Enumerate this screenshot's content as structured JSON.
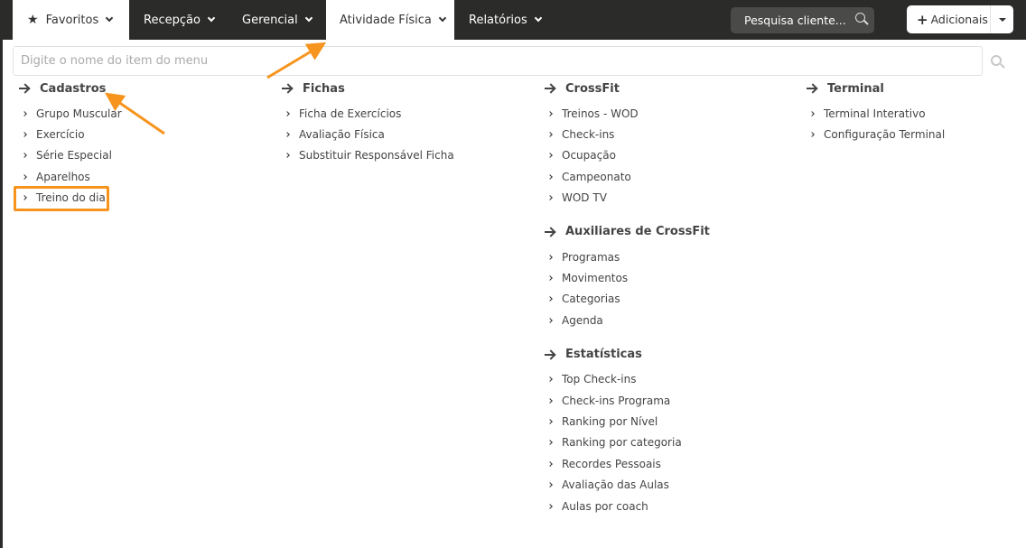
{
  "nav": {
    "tabs": [
      {
        "label": "Favoritos"
      },
      {
        "label": "Recepção"
      },
      {
        "label": "Gerencial"
      },
      {
        "label": "Atividade Física"
      },
      {
        "label": "Relatórios"
      }
    ],
    "search_label": "Pesquisa cliente...",
    "add_label": "Adicionais"
  },
  "menu_search": {
    "placeholder": "Digite o nome do item do menu"
  },
  "sections": {
    "cadastros": {
      "title": "Cadastros",
      "items": [
        "Grupo Muscular",
        "Exercício",
        "Série Especial",
        "Aparelhos",
        "Treino do dia"
      ]
    },
    "fichas": {
      "title": "Fichas",
      "items": [
        "Ficha de Exercícios",
        "Avaliação Física",
        "Substituir Responsável Ficha"
      ]
    },
    "crossfit": {
      "title": "CrossFit",
      "items": [
        "Treinos - WOD",
        "Check-ins",
        "Ocupação",
        "Campeonato",
        "WOD TV"
      ]
    },
    "auxiliares": {
      "title": "Auxiliares de CrossFit",
      "items": [
        "Programas",
        "Movimentos",
        "Categorias",
        "Agenda"
      ]
    },
    "estatisticas": {
      "title": "Estatísticas",
      "items": [
        "Top Check-ins",
        "Check-ins Programa",
        "Ranking por Nível",
        "Ranking por categoria",
        "Recordes Pessoais",
        "Avaliação das Aulas",
        "Aulas por coach"
      ]
    },
    "terminal": {
      "title": "Terminal",
      "items": [
        "Terminal Interativo",
        "Configuração Terminal"
      ]
    }
  },
  "colors": {
    "nav_bg": "#2b2c2a",
    "annotation": "#f7941d"
  },
  "icons": {
    "favoritos": "star-icon",
    "search": "search-icon",
    "add": "plus-icon"
  }
}
